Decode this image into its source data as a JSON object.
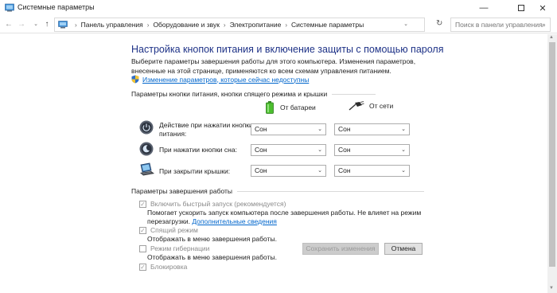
{
  "window": {
    "title": "Системные параметры",
    "minimize": "—",
    "close": "✕"
  },
  "address": {
    "back": "←",
    "forward": "→",
    "recent": "⌄",
    "up": "↑",
    "crumbs": [
      "Панель управления",
      "Оборудование и звук",
      "Электропитание",
      "Системные параметры"
    ],
    "separator": "›",
    "dropdown": "⌄",
    "refresh": "↻",
    "search_placeholder": "Поиск в панели управления",
    "search_icon": "⌕"
  },
  "main": {
    "heading": "Настройка кнопок питания и включение защиты с помощью пароля",
    "description": "Выберите параметры завершения работы для этого компьютера. Изменения параметров, внесенные на этой странице, применяются ко всем схемам управления питанием.",
    "change_link": "Изменение параметров, которые сейчас недоступны",
    "buttons_section": "Параметры кнопки питания, кнопки спящего режима и крышки",
    "col_battery": "От батареи",
    "col_plugged": "От сети",
    "rows": [
      {
        "label_line1": "Действие при нажатии кнопки",
        "label_line2": "питания:",
        "battery": "Сон",
        "plugged": "Сон"
      },
      {
        "label_line1": "При нажатии кнопки сна:",
        "label_line2": "",
        "battery": "Сон",
        "plugged": "Сон"
      },
      {
        "label_line1": "При закрытии крышки:",
        "label_line2": "",
        "battery": "Сон",
        "plugged": "Сон"
      }
    ],
    "caret": "⌄",
    "shutdown_section": "Параметры завершения работы",
    "options": [
      {
        "label": "Включить быстрый запуск (рекомендуется)",
        "checked": true,
        "desc1": "Помогает ускорить запуск компьютера после завершения работы. Не влияет на режим",
        "desc2": "перезагрузки.",
        "link": "Дополнительные сведения"
      },
      {
        "label": "Спящий режим",
        "checked": true,
        "desc1": "Отображать в меню завершения работы."
      },
      {
        "label": "Режим гибернации",
        "checked": false,
        "desc1": "Отображать в меню завершения работы."
      },
      {
        "label": "Блокировка",
        "checked": true
      }
    ],
    "checkmark": "✓",
    "save_button": "Сохранить изменения",
    "cancel_button": "Отмена"
  },
  "scrollbar": {
    "up": "▲",
    "down": "▼"
  }
}
